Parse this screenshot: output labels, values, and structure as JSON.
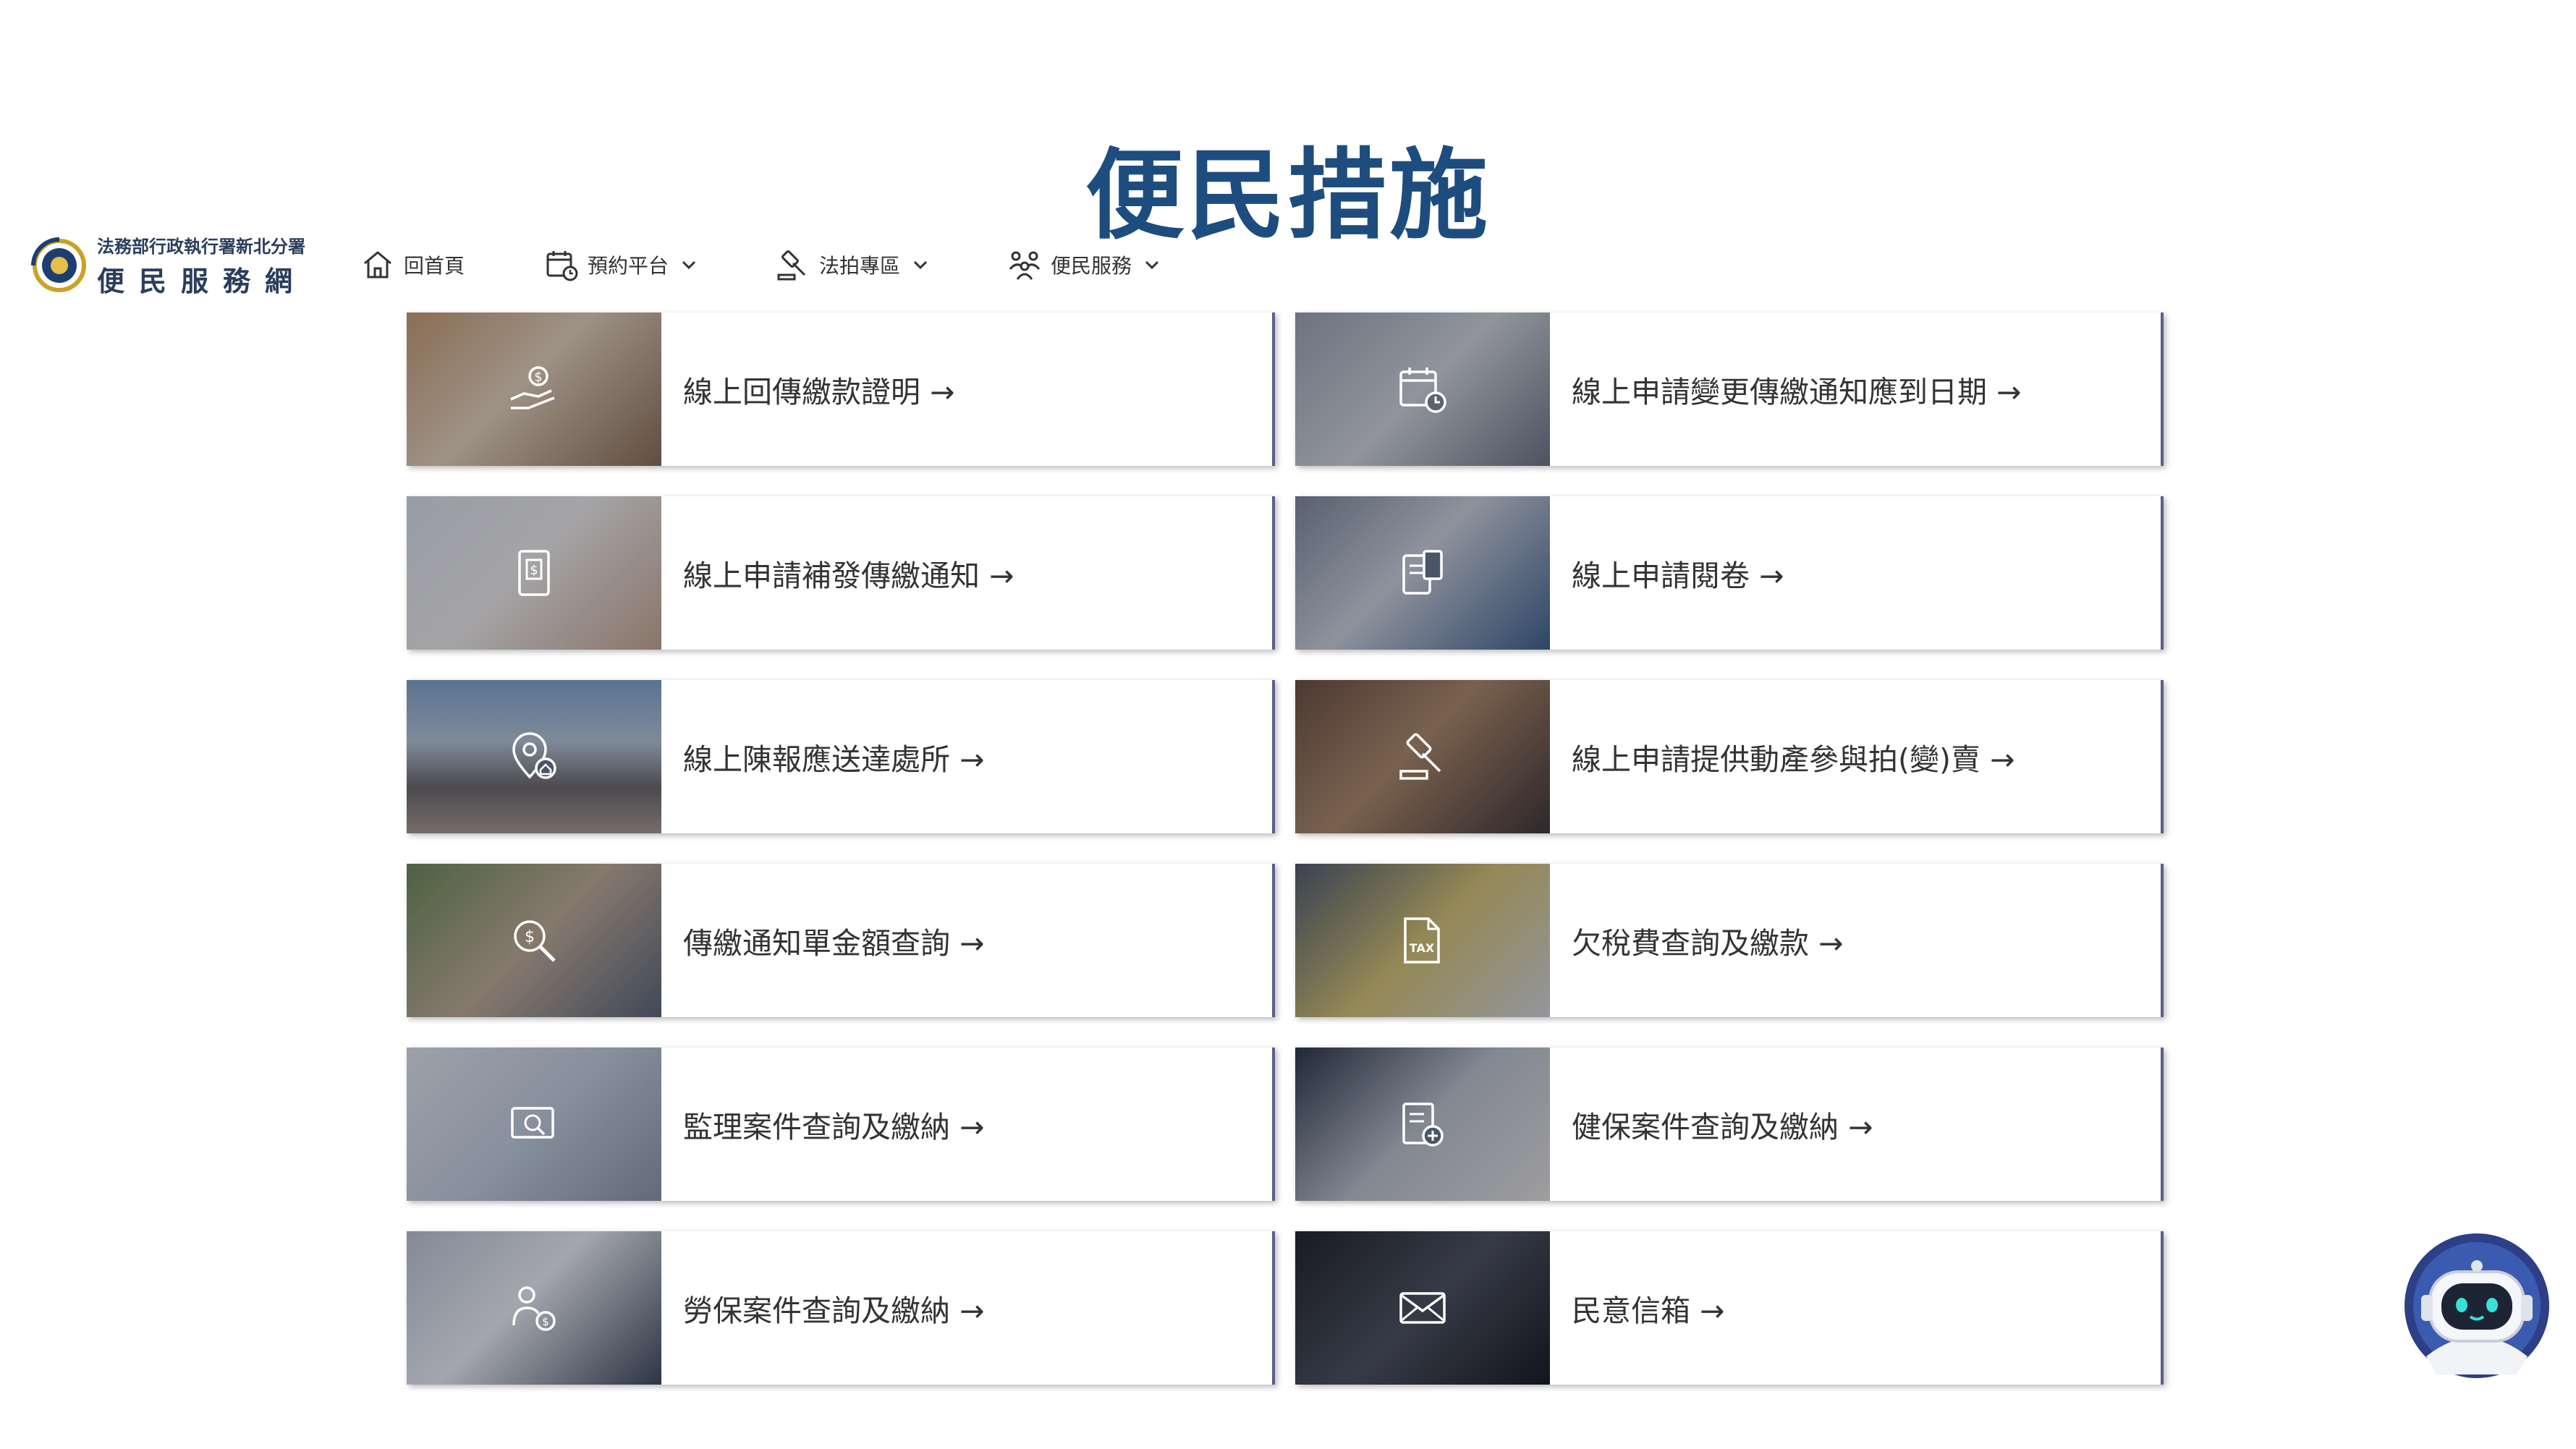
{
  "page_title": "便民措施",
  "logo": {
    "agency": "法務部行政執行署新北分署",
    "site_name": "便民服務網"
  },
  "nav": [
    {
      "label": "回首頁",
      "icon": "home-icon"
    },
    {
      "label": "預約平台",
      "icon": "calendar-clock-icon"
    },
    {
      "label": "法拍專區",
      "icon": "auction-gavel-icon"
    },
    {
      "label": "便民服務",
      "icon": "people-group-icon"
    }
  ],
  "cards": [
    {
      "label": "線上回傳繳款證明 →",
      "icon": "hand-coin-icon"
    },
    {
      "label": "線上申請變更傳繳通知應到日期 →",
      "icon": "calendar-clock-icon"
    },
    {
      "label": "線上申請補發傳繳通知 →",
      "icon": "dollar-document-icon"
    },
    {
      "label": "線上申請閱卷 →",
      "icon": "file-tablet-icon"
    },
    {
      "label": "線上陳報應送達處所 →",
      "icon": "location-home-icon"
    },
    {
      "label": "線上申請提供動產參與拍(變)賣 →",
      "icon": "auction-gavel-icon"
    },
    {
      "label": "傳繳通知單金額查詢 →",
      "icon": "search-dollar-icon"
    },
    {
      "label": "欠稅費查詢及繳款 →",
      "icon": "tax-document-icon"
    },
    {
      "label": "監理案件查詢及繳納 →",
      "icon": "search-card-icon"
    },
    {
      "label": "健保案件查詢及繳納 →",
      "icon": "health-document-icon"
    },
    {
      "label": "勞保案件查詢及繳納 →",
      "icon": "worker-coin-icon"
    },
    {
      "label": "民意信箱 →",
      "icon": "envelope-icon"
    }
  ],
  "colors": {
    "title": "#1d4d7e",
    "card_border": "#5a5f8a"
  },
  "chatbot": {
    "icon": "robot-assistant-icon"
  }
}
